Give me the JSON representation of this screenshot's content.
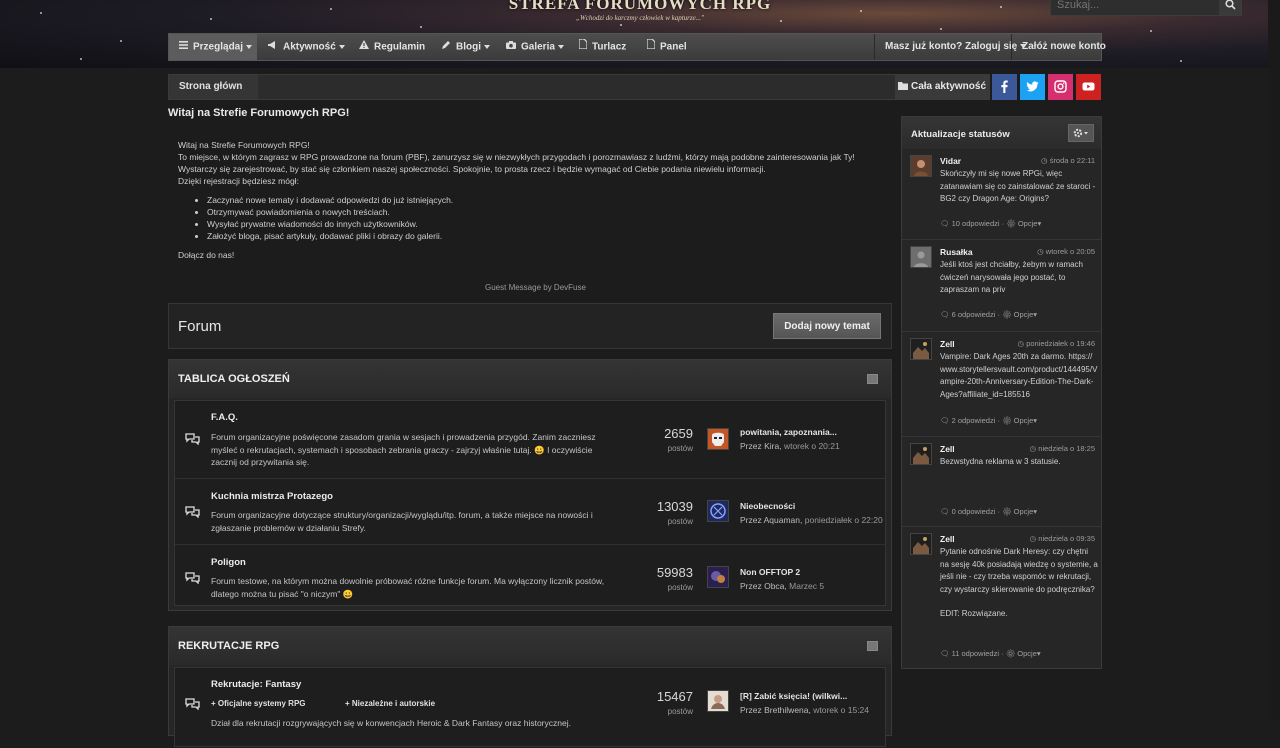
{
  "header": {
    "logo_title": "STREFA FORUMOWYCH RPG",
    "logo_subtitle": "„Wchodzi do karczmy człowiek w kapturze...\"",
    "search_placeholder": "Szukaj..."
  },
  "nav": {
    "items": [
      {
        "label": "Przeglądaj",
        "icon": "list-icon",
        "has_caret": true
      },
      {
        "label": "Aktywność",
        "icon": "megaphone-icon",
        "has_caret": true
      },
      {
        "label": "Regulamin",
        "icon": "warning-icon",
        "has_caret": false
      },
      {
        "label": "Blogi",
        "icon": "pencil-icon",
        "has_caret": true
      },
      {
        "label": "Galeria",
        "icon": "camera-icon",
        "has_caret": true
      },
      {
        "label": "Turlacz",
        "icon": "document-icon",
        "has_caret": false
      },
      {
        "label": "Panel",
        "icon": "document-icon",
        "has_caret": false
      }
    ],
    "login_label": "Masz już konto? Zaloguj się",
    "register_label": "Załóż nowe konto"
  },
  "breadcrumb": {
    "home": "Strona główna",
    "all_activity": "Cała aktywność"
  },
  "social": [
    {
      "name": "facebook",
      "color": "#3b5998"
    },
    {
      "name": "twitter",
      "color": "#1da1f2"
    },
    {
      "name": "instagram",
      "color": "#d62f6f"
    },
    {
      "name": "youtube",
      "color": "#cc2222"
    }
  ],
  "welcome": {
    "title": "Witaj na Strefie Forumowych RPG!",
    "line1": "Witaj na Strefie Forumowych RPG!",
    "line2": "To miejsce, w którym zagrasz w RPG prowadzone na forum (PBF), zanurzysz się w niezwykłych przygodach i porozmawiasz z ludźmi, którzy mają podobne zainteresowania jak Ty! Wystarczy się zarejestrować, by stać się członkiem naszej społeczności. Spokojnie, to prosta rzecz i będzie wymagać od Ciebie podania niewielu informacji.",
    "line3": "Dzięki rejestracji będziesz mógł:",
    "bullets": [
      "Zaczynać nowe tematy i dodawać odpowiedzi do już istniejących.",
      "Otrzymywać powiadomienia o nowych treściach.",
      "Wysyłać prywatne wiadomości do innych użytkowników.",
      "Założyć bloga, pisać artykuły, dodawać pliki i obrazy do galerii."
    ],
    "closing": "Dołącz do nas!",
    "credit": "Guest Message by DevFuse"
  },
  "forum": {
    "title": "Forum",
    "new_topic_label": "Dodaj nowy temat"
  },
  "categories": [
    {
      "title": "TABLICA OGŁOSZEŃ",
      "forums": [
        {
          "title": "F.A.Q.",
          "description": "Forum organizacyjne poświęcone zasadom grania w sesjach i prowadzenia przygód. Zanim zaczniesz myśleć o rekrutacjach, systemach i sposobach zebrania graczy - zajrzyj właśnie tutaj. 😀 I oczywiście zacznij od przywitania się.",
          "count": "2659",
          "count_label": "postów",
          "last_title": "powitania, zapoznania...",
          "last_by": "Przez Kira,",
          "last_date": "wtorek o 20:21"
        },
        {
          "title": "Kuchnia mistrza Protazego",
          "description": "Forum organizacyjne dotyczące struktury/organizacji/wyglądu/itp. forum, a także miejsce na nowości i zgłaszanie problemów w działaniu Strefy.",
          "count": "13039",
          "count_label": "postów",
          "last_title": "Nieobecności",
          "last_by": "Przez Aquaman,",
          "last_date": "poniedziałek o 22:20"
        },
        {
          "title": "Poligon",
          "description": "Forum testowe, na którym można dowolnie próbować różne funkcje forum. Ma wyłączony licznik postów, dlatego można tu pisać \"o niczym\" 😀",
          "count": "59983",
          "count_label": "postów",
          "last_title": "Non OFFTOP 2",
          "last_by": "Przez Obca,",
          "last_date": "Marzec 5"
        }
      ]
    },
    {
      "title": "REKRUTACJE RPG",
      "forums": [
        {
          "title": "Rekrutacje: Fantasy",
          "subforums": [
            "Oficjalne systemy RPG",
            "Niezależne i autorskie"
          ],
          "description": "Dział dla rekrutacji rozgrywających się w konwencjach Heroic & Dark Fantasy oraz historycznej.",
          "count": "15467",
          "count_label": "postów",
          "last_title": "[R] Zabić księcia! (wilkwi...",
          "last_by": "Przez Brethilwena,",
          "last_date": "wtorek o 15:24"
        }
      ]
    }
  ],
  "status_updates": {
    "title": "Aktualizacje statusów",
    "items": [
      {
        "author": "Vidar",
        "time": "środa o 22:11",
        "text": [
          "Skończyły mi się nowe RPGi, więc zatanawiam się co zainstalować ze staroci - BG2 czy Dragon Age: Origins?"
        ],
        "replies": "10 odpowiedzi",
        "options": "Opcje"
      },
      {
        "author": "Rusałka",
        "time": "wtorek o 20:05",
        "text": [
          "Jeśli ktoś jest chciałby, żebym w ramach ćwiczeń narysowała jego postać, to zapraszam na priv"
        ],
        "replies": "6 odpowiedzi",
        "options": "Opcje"
      },
      {
        "author": "Zell",
        "time": "poniedziałek o 19:46",
        "text": [
          "Vampire: Dark Ages 20th za darmo. https://www.storytellersvault.com/product/144495/Vampire-20th-Anniversary-Edition-The-Dark-Ages?affiliate_id=185516"
        ],
        "replies": "2 odpowiedzi",
        "options": "Opcje"
      },
      {
        "author": "Zell",
        "time": "niedziela o 18:25",
        "text": [
          "Bezwstydna reklama w 3 statusie."
        ],
        "replies": "0 odpowiedzi",
        "options": "Opcje"
      },
      {
        "author": "Zell",
        "time": "niedziela o 09:35",
        "text": [
          "Pytanie odnośnie Dark Heresy: czy chętni na sesję 40k posiadają wiedzę o systemie, a jeśli nie - czy trzeba wspomóc w rekrutacji, czy wystarczy skierowanie do podręcznika?",
          "EDIT: Rozwiązane."
        ],
        "replies": "11 odpowiedzi",
        "options": "Opcje"
      }
    ]
  }
}
